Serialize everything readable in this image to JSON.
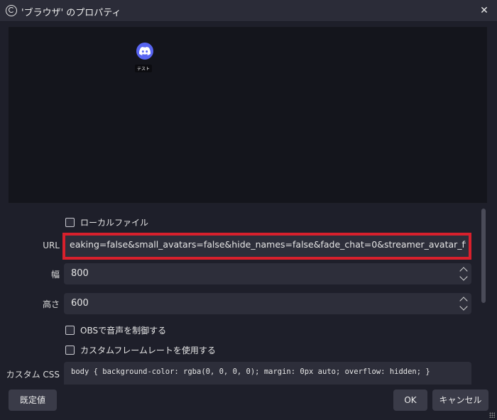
{
  "window": {
    "title": "'ブラウザ' のプロパティ",
    "close_glyph": "✕"
  },
  "preview": {
    "overlay_label": "テスト"
  },
  "form": {
    "local_file": {
      "label": "ローカルファイル",
      "checked": false
    },
    "url": {
      "label": "URL",
      "value": "eaking=false&small_avatars=false&hide_names=false&fade_chat=0&streamer_avatar_first=false"
    },
    "width": {
      "label": "幅",
      "value": "800"
    },
    "height": {
      "label": "高さ",
      "value": "600"
    },
    "control_audio": {
      "label": "OBSで音声を制御する",
      "checked": false
    },
    "custom_framerate": {
      "label": "カスタムフレームレートを使用する",
      "checked": false
    },
    "custom_css": {
      "label": "カスタム CSS",
      "value": "body { background-color: rgba(0, 0, 0, 0); margin: 0px auto; overflow: hidden; }"
    }
  },
  "buttons": {
    "defaults": "既定値",
    "ok": "OK",
    "cancel": "キャンセル"
  },
  "colors": {
    "highlight": "#d8202c",
    "discord": "#5865f2",
    "background": "#1e1f2a"
  }
}
